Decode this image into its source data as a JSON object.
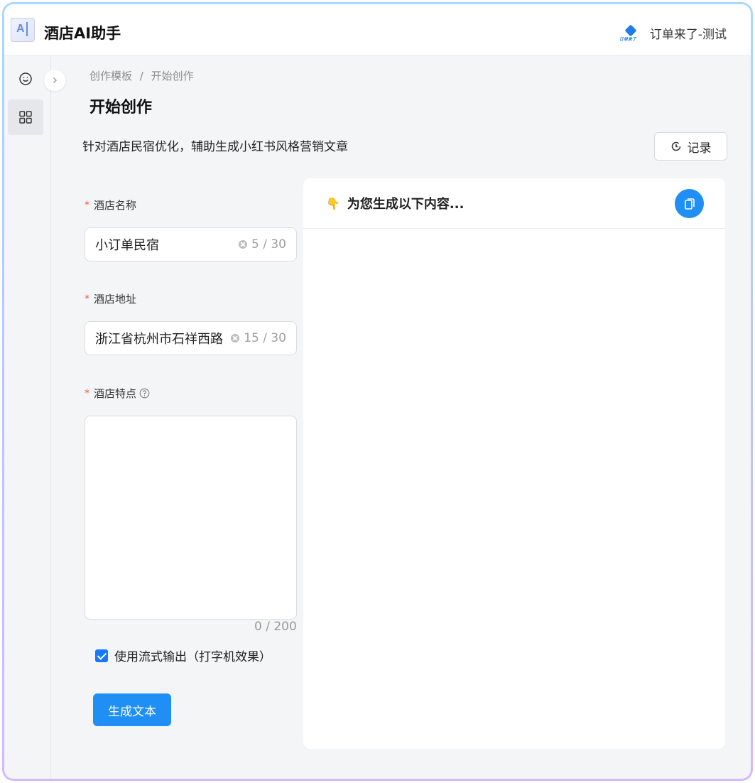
{
  "header": {
    "logo_text": "A",
    "app_title": "酒店AI助手",
    "brand_logo_text": "订单来了",
    "account_name": "订单来了-测试"
  },
  "sidebar": {
    "items": [
      {
        "icon": "smile-icon"
      },
      {
        "icon": "grid-icon",
        "active": true
      }
    ]
  },
  "breadcrumb": {
    "items": [
      "创作模板",
      "/",
      "开始创作"
    ]
  },
  "main": {
    "page_title": "开始创作",
    "subtitle": "针对酒店民宿优化，辅助生成小红书风格营销文章",
    "history_button": "记录"
  },
  "form": {
    "hotel_name": {
      "required_mark": "*",
      "label": "酒店名称",
      "value": "小订单民宿",
      "count": "5 / 30"
    },
    "hotel_address": {
      "required_mark": "*",
      "label": "酒店地址",
      "value": "浙江省杭州市石祥西路",
      "count": "15 / 30"
    },
    "hotel_features": {
      "required_mark": "*",
      "label": "酒店特点",
      "value": "",
      "count": "0 / 200"
    },
    "stream_output": {
      "checked": true,
      "label": "使用流式输出（打字机效果）"
    },
    "generate_button": "生成文本"
  },
  "output_panel": {
    "emoji": "👇",
    "heading": "为您生成以下内容...",
    "content": ""
  },
  "colors": {
    "accent": "#1f8ef5",
    "required": "#ff4d4f"
  }
}
